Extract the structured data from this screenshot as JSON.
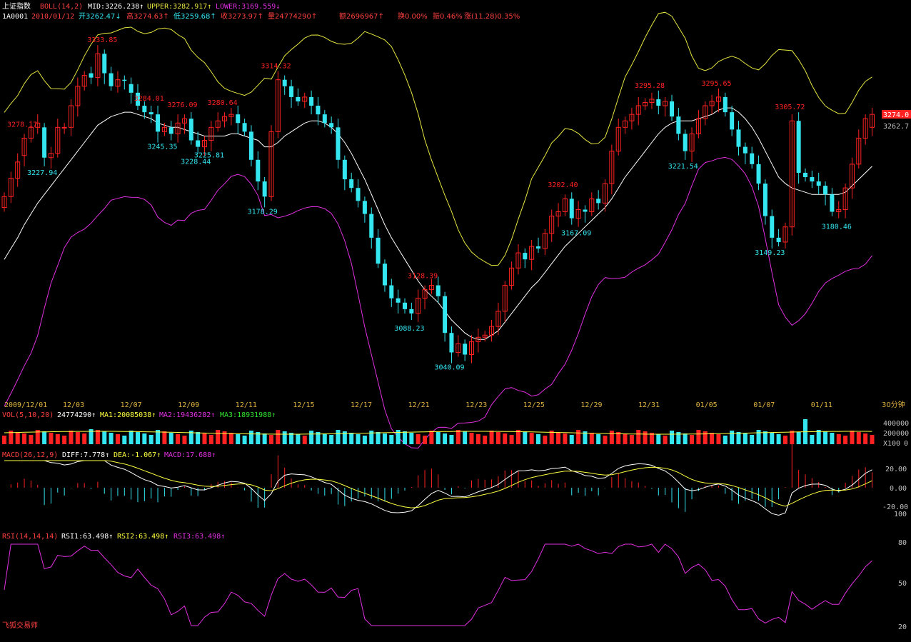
{
  "header": {
    "index_name": "上证指数",
    "boll_label": "BOLL(14,2)",
    "mid_label": "MID:3226.238↑",
    "upper_label": "UPPER:3282.917↑",
    "lower_label": "LOWER:3169.559↓",
    "code": "1A0001",
    "date": "2010/01/12",
    "open": "开3262.47↓",
    "high": "高3274.63↑",
    "low": "低3259.68↑",
    "close": "收3273.97↑",
    "volume": "量24774290↑",
    "amount": "额2696967↑",
    "turnover": "换0.00%",
    "amplitude": "振0.46%",
    "change": "涨(11.28)0.35%"
  },
  "price_panel": {
    "current_price": "3274.0",
    "second_price": "3262.7",
    "annotations": [
      {
        "text": "3278.17",
        "kind": "high",
        "i": 3
      },
      {
        "text": "3227.94",
        "kind": "low",
        "i": 6
      },
      {
        "text": "3333.85",
        "kind": "high",
        "i": 15
      },
      {
        "text": "3284.01",
        "kind": "high",
        "i": 22
      },
      {
        "text": "3245.35",
        "kind": "low",
        "i": 24
      },
      {
        "text": "3276.09",
        "kind": "high",
        "i": 27
      },
      {
        "text": "3228.44",
        "kind": "low",
        "i": 29
      },
      {
        "text": "3225.81",
        "kind": "low",
        "i": 31
      },
      {
        "text": "3280.64",
        "kind": "high",
        "i": 33
      },
      {
        "text": "3178.29",
        "kind": "low",
        "i": 39
      },
      {
        "text": "3314.32",
        "kind": "high",
        "i": 41
      },
      {
        "text": "3088.23",
        "kind": "low",
        "i": 61
      },
      {
        "text": "3128.39",
        "kind": "high",
        "i": 63
      },
      {
        "text": "3040.09",
        "kind": "low",
        "i": 67
      },
      {
        "text": "3202.40",
        "kind": "high",
        "i": 84
      },
      {
        "text": "3167.09",
        "kind": "low",
        "i": 86
      },
      {
        "text": "3295.28",
        "kind": "high",
        "i": 97
      },
      {
        "text": "3221.54",
        "kind": "low",
        "i": 102
      },
      {
        "text": "3295.65",
        "kind": "high",
        "i": 107
      },
      {
        "text": "3149.23",
        "kind": "low",
        "i": 115
      },
      {
        "text": "3305.72",
        "kind": "high",
        "i": 118
      },
      {
        "text": "3180.46",
        "kind": "low",
        "i": 125
      }
    ]
  },
  "date_axis": {
    "labels": [
      "2009/12/01",
      "12/03",
      "12/07",
      "12/09",
      "12/11",
      "12/15",
      "12/17",
      "12/21",
      "12/23",
      "12/25",
      "12/29",
      "12/31",
      "01/05",
      "01/07",
      "01/11"
    ],
    "period": "30分钟"
  },
  "vol_panel": {
    "title": "VOL(5,10,20)",
    "value": "24774290↑",
    "ma1": "MA1:20085038↑",
    "ma2": "MA2:19436282↑",
    "ma3": "MA3:18931988↑",
    "axis": [
      "400000",
      "200000",
      "0"
    ],
    "unit": "X100"
  },
  "macd_panel": {
    "title": "MACD(26,12,9)",
    "diff": "DIFF:7.778↑",
    "dea": "DEA:-1.067↑",
    "macd": "MACD:17.688↑",
    "axis": [
      "20.00",
      "0.00",
      "-20.00",
      "100"
    ]
  },
  "rsi_panel": {
    "title": "RSI(14,14,14)",
    "rsi1": "RSI1:63.498↑",
    "rsi2": "RSI2:63.498↑",
    "rsi3": "RSI3:63.498↑",
    "axis": [
      "80",
      "50",
      "20"
    ]
  },
  "footer": {
    "brand": "飞狐交易师"
  },
  "colors": {
    "up": "#ff2222",
    "down": "#33e6f0",
    "mid": "#ffffff",
    "upper": "#e6e640",
    "lower": "#e030e0",
    "text_gray": "#c0c0c0"
  },
  "chart_data": {
    "type": "candlestick",
    "price_range": [
      3020,
      3350
    ],
    "closes": [
      3198,
      3215,
      3230,
      3252,
      3262,
      3266,
      3234,
      3238,
      3262,
      3262,
      3282,
      3300,
      3310,
      3308,
      3330,
      3312,
      3300,
      3306,
      3305,
      3294,
      3282,
      3276,
      3274,
      3258,
      3262,
      3256,
      3266,
      3270,
      3250,
      3244,
      3250,
      3262,
      3268,
      3272,
      3274,
      3266,
      3258,
      3232,
      3212,
      3198,
      3258,
      3306,
      3300,
      3290,
      3286,
      3290,
      3282,
      3274,
      3266,
      3262,
      3232,
      3214,
      3206,
      3194,
      3182,
      3160,
      3136,
      3116,
      3104,
      3100,
      3094,
      3090,
      3104,
      3112,
      3116,
      3106,
      3072,
      3054,
      3062,
      3052,
      3064,
      3068,
      3070,
      3078,
      3092,
      3116,
      3132,
      3146,
      3140,
      3152,
      3150,
      3164,
      3180,
      3184,
      3196,
      3178,
      3186,
      3184,
      3196,
      3192,
      3210,
      3240,
      3262,
      3268,
      3274,
      3282,
      3285,
      3288,
      3282,
      3286,
      3272,
      3256,
      3240,
      3256,
      3270,
      3282,
      3286,
      3290,
      3276,
      3260,
      3244,
      3238,
      3228,
      3210,
      3180,
      3160,
      3156,
      3170,
      3268,
      3220,
      3216,
      3212,
      3208,
      3200,
      3184,
      3186,
      3206,
      3228,
      3252,
      3270,
      3274
    ],
    "opens": [
      3188,
      3198,
      3215,
      3236,
      3252,
      3262,
      3262,
      3234,
      3238,
      3262,
      3262,
      3282,
      3300,
      3312,
      3308,
      3330,
      3312,
      3300,
      3306,
      3302,
      3294,
      3282,
      3276,
      3274,
      3258,
      3262,
      3256,
      3266,
      3270,
      3250,
      3244,
      3250,
      3262,
      3268,
      3272,
      3274,
      3266,
      3258,
      3232,
      3212,
      3198,
      3258,
      3306,
      3300,
      3290,
      3286,
      3290,
      3282,
      3274,
      3266,
      3262,
      3232,
      3214,
      3206,
      3194,
      3182,
      3160,
      3136,
      3116,
      3104,
      3100,
      3094,
      3090,
      3104,
      3112,
      3116,
      3106,
      3072,
      3054,
      3062,
      3052,
      3064,
      3068,
      3070,
      3078,
      3092,
      3116,
      3132,
      3146,
      3140,
      3152,
      3150,
      3164,
      3180,
      3184,
      3196,
      3178,
      3186,
      3184,
      3196,
      3192,
      3210,
      3240,
      3262,
      3268,
      3274,
      3282,
      3285,
      3288,
      3282,
      3286,
      3272,
      3256,
      3240,
      3256,
      3270,
      3282,
      3286,
      3290,
      3276,
      3260,
      3244,
      3238,
      3228,
      3210,
      3180,
      3160,
      3156,
      3170,
      3268,
      3220,
      3216,
      3212,
      3208,
      3200,
      3184,
      3186,
      3206,
      3228,
      3252,
      3262
    ],
    "mid_band": [
      3140,
      3150,
      3160,
      3172,
      3182,
      3192,
      3200,
      3208,
      3216,
      3224,
      3232,
      3240,
      3248,
      3256,
      3264,
      3268,
      3272,
      3274,
      3276,
      3276,
      3274,
      3272,
      3270,
      3266,
      3264,
      3262,
      3262,
      3260,
      3258,
      3256,
      3254,
      3254,
      3254,
      3254,
      3256,
      3256,
      3254,
      3252,
      3250,
      3244,
      3244,
      3248,
      3254,
      3258,
      3262,
      3266,
      3268,
      3268,
      3266,
      3262,
      3256,
      3248,
      3238,
      3226,
      3214,
      3200,
      3186,
      3172,
      3160,
      3150,
      3140,
      3130,
      3120,
      3112,
      3106,
      3100,
      3092,
      3084,
      3078,
      3072,
      3068,
      3066,
      3066,
      3070,
      3074,
      3082,
      3090,
      3098,
      3106,
      3114,
      3120,
      3128,
      3136,
      3144,
      3152,
      3158,
      3164,
      3170,
      3176,
      3182,
      3188,
      3196,
      3206,
      3216,
      3224,
      3232,
      3240,
      3248,
      3256,
      3262,
      3266,
      3268,
      3268,
      3268,
      3270,
      3272,
      3274,
      3278,
      3280,
      3280,
      3276,
      3270,
      3262,
      3252,
      3240,
      3228,
      3216,
      3210,
      3206,
      3204,
      3202,
      3200,
      3200,
      3200,
      3200,
      3200,
      3202,
      3208,
      3214,
      3220,
      3226
    ]
  }
}
